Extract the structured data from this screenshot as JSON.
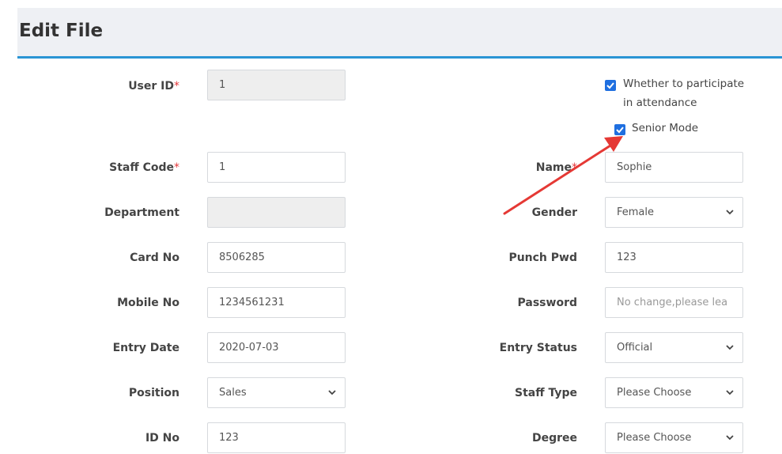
{
  "header": {
    "title": "Edit File"
  },
  "required_mark": "*",
  "form": {
    "user_id": {
      "label": "User ID",
      "value": "1"
    },
    "staff_code": {
      "label": "Staff Code",
      "value": "1"
    },
    "department": {
      "label": "Department",
      "value": ""
    },
    "card_no": {
      "label": "Card No",
      "value": "8506285"
    },
    "mobile_no": {
      "label": "Mobile No",
      "value": "1234561231"
    },
    "entry_date": {
      "label": "Entry Date",
      "value": "2020-07-03"
    },
    "position": {
      "label": "Position",
      "value": "Sales"
    },
    "id_no": {
      "label": "ID No",
      "value": "123"
    },
    "name": {
      "label": "Name",
      "value": "Sophie"
    },
    "gender": {
      "label": "Gender",
      "value": "Female"
    },
    "punch_pwd": {
      "label": "Punch Pwd",
      "value": "123"
    },
    "password": {
      "label": "Password",
      "placeholder": "No change,please lea"
    },
    "entry_status": {
      "label": "Entry Status",
      "value": "Official"
    },
    "staff_type": {
      "label": "Staff Type",
      "value": "Please Choose"
    },
    "degree": {
      "label": "Degree",
      "value": "Please Choose"
    }
  },
  "checkboxes": {
    "attendance": {
      "label_line1": "Whether to participate",
      "label_line2": "in attendance",
      "checked": true
    },
    "senior_mode": {
      "label": "Senior Mode",
      "checked": true
    }
  },
  "colors": {
    "accent": "#2a95d4",
    "checkbox": "#1f6fe0",
    "annotation_arrow": "#e53935",
    "required": "#e4393c"
  },
  "icons": {
    "select_chevron": "chevron-down-icon",
    "checkbox": "checkmark-icon"
  }
}
